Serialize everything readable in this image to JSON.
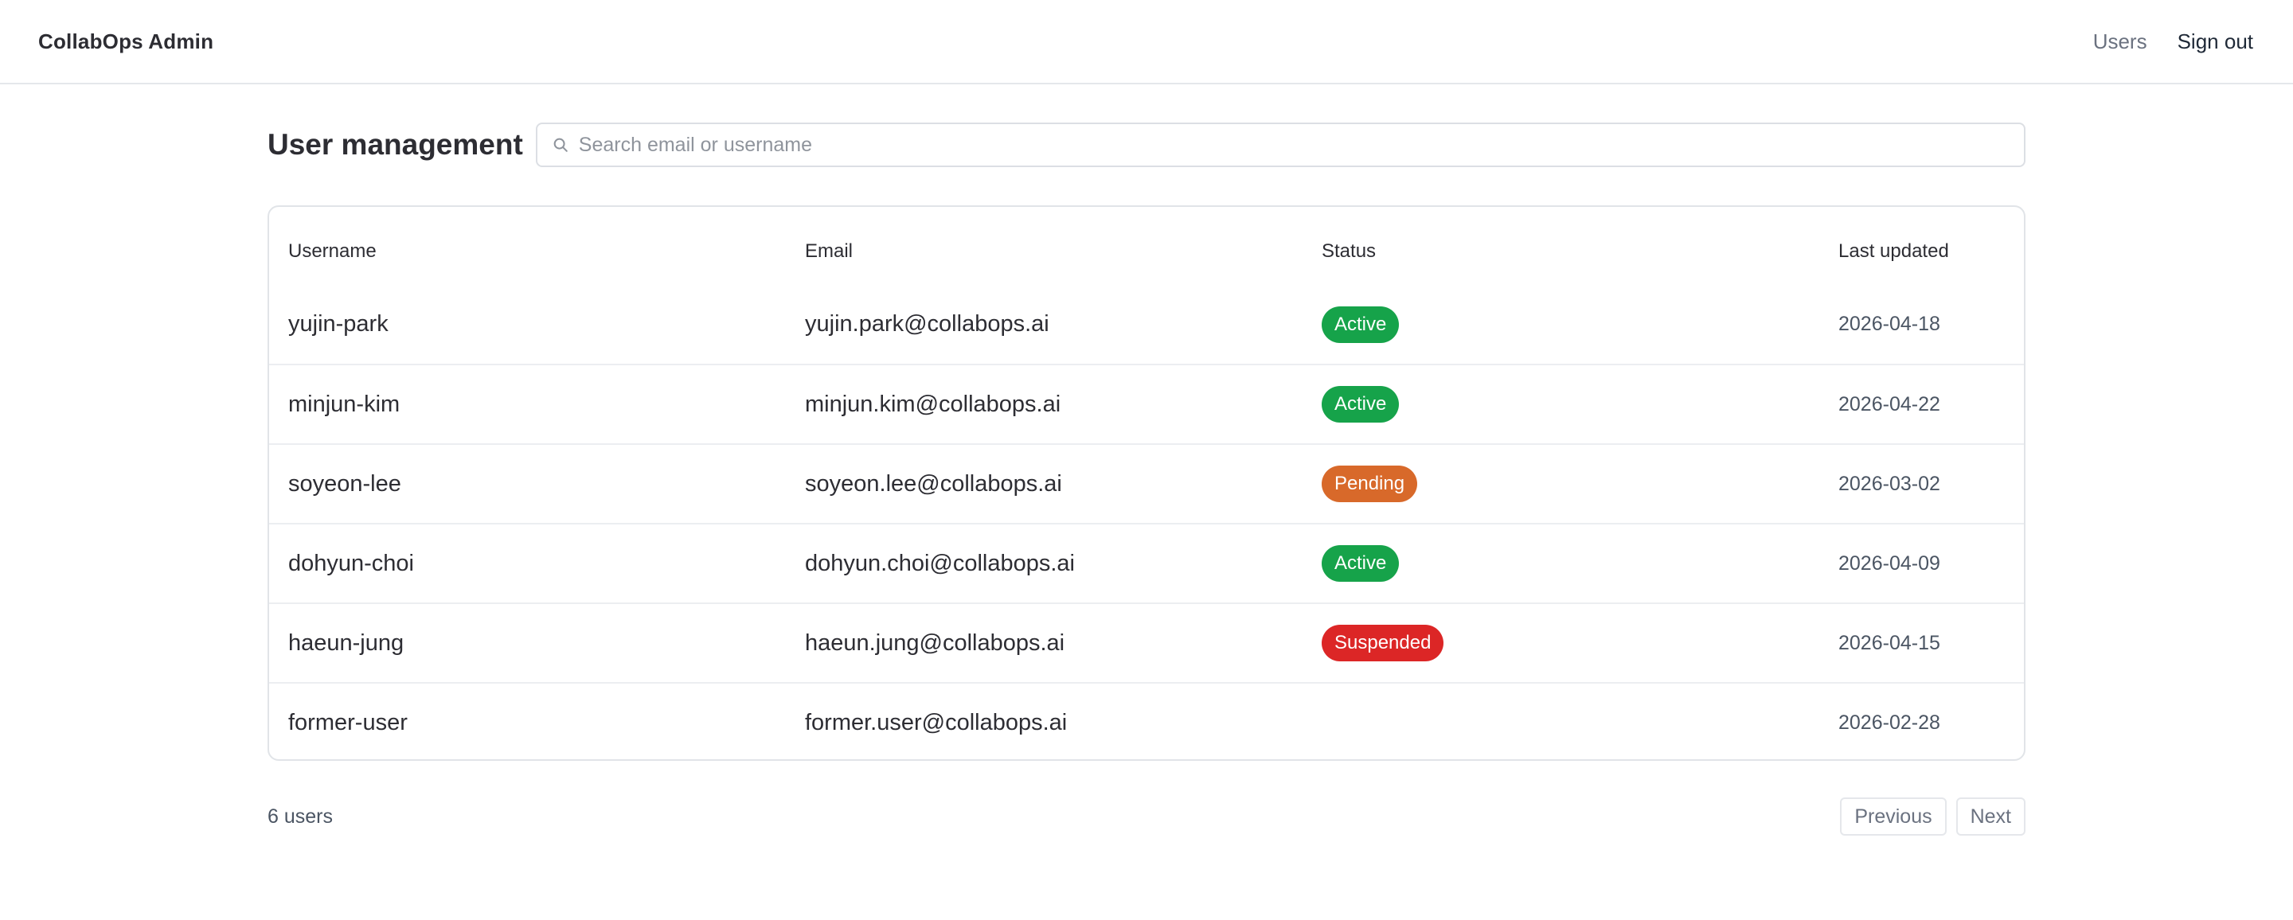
{
  "app": {
    "title": "CollabOps Admin"
  },
  "nav": {
    "users_label": "Users",
    "signout_label": "Sign out"
  },
  "page": {
    "title": "User management"
  },
  "search": {
    "placeholder": "Search email or username",
    "value": ""
  },
  "table": {
    "headers": {
      "username": "Username",
      "email": "Email",
      "status": "Status",
      "updated": "Last updated"
    },
    "rows": [
      {
        "username": "yujin-park",
        "email": "yujin.park@collabops.ai",
        "status": "Active",
        "updated": "2026-04-18"
      },
      {
        "username": "minjun-kim",
        "email": "minjun.kim@collabops.ai",
        "status": "Active",
        "updated": "2026-04-22"
      },
      {
        "username": "soyeon-lee",
        "email": "soyeon.lee@collabops.ai",
        "status": "Pending",
        "updated": "2026-03-02"
      },
      {
        "username": "dohyun-choi",
        "email": "dohyun.choi@collabops.ai",
        "status": "Active",
        "updated": "2026-04-09"
      },
      {
        "username": "haeun-jung",
        "email": "haeun.jung@collabops.ai",
        "status": "Suspended",
        "updated": "2026-04-15"
      },
      {
        "username": "former-user",
        "email": "former.user@collabops.ai",
        "status": "",
        "updated": "2026-02-28"
      }
    ]
  },
  "status_colors": {
    "Active": "#16a34a",
    "Pending": "#d8692a",
    "Suspended": "#dc2626"
  },
  "footer": {
    "count_label": "6 users",
    "previous_label": "Previous",
    "next_label": "Next"
  },
  "icons": {
    "search": "search-icon"
  }
}
